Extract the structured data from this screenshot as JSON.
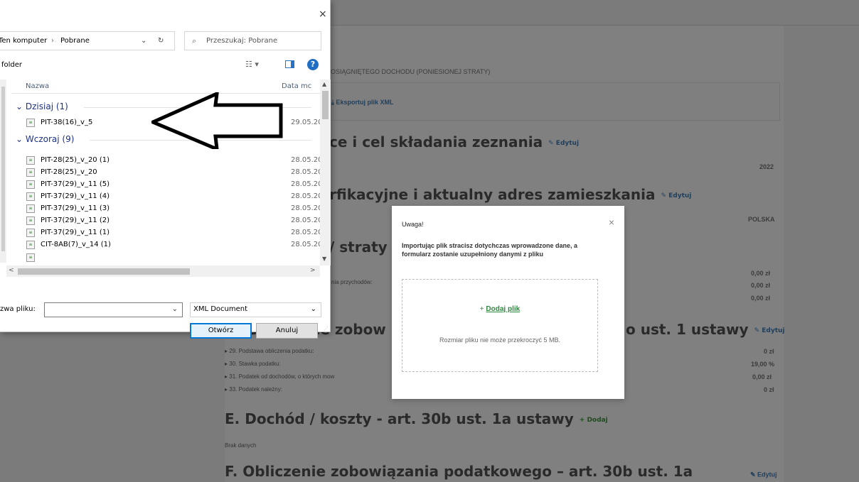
{
  "background": {
    "heading_fragment": "OSIĄGNIĘTEGO DOCHODU (PONIESIONEJ STRATY)",
    "export_link": "Eksportuj plik XML",
    "sections": {
      "b_title": "ce i cel składania zeznania",
      "c_title": "rfikacyjne i aktualny adres zamieszkania",
      "d_fragment_title": "/ straty -",
      "d_title": "D. Obliczenie zobow",
      "d_title_tail": "o ust. 1 ustawy",
      "e_title": "E. Dochód / koszty - art. 30b ust. 1a ustawy",
      "f_title": "F. Obliczenie zobowiązania podatkowego – art. 30b ust. 1a"
    },
    "edit_label": "Edytuj",
    "add_label": "+ Dodaj",
    "year_value": "2022",
    "country_value": "POLSKA",
    "income_label_fragment": "nia przychodów:",
    "money_values": [
      "0,00 zł",
      "0,00 zł",
      "0,00 zł"
    ],
    "tax_rows": [
      {
        "label": "▸ 29. Podstawa obliczenia podatku:",
        "value": "0 zł"
      },
      {
        "label": "▸ 30. Stawka podatku:",
        "value": "19,00 %"
      },
      {
        "label": "▸ 31. Podatek od dochodów, o których mow",
        "value": "0,00 zł"
      },
      {
        "label": "▸ 33. Podatek należny:",
        "value": "0 zł"
      }
    ],
    "no_data": "Brak danych"
  },
  "modal": {
    "title": "Uwaga!",
    "close": "×",
    "message": "Importując plik stracisz dotychczas wprowadzone dane, a formularz zostanie uzupełniony danymi z pliku",
    "add_plus": "+",
    "add_file": "Dodaj plik",
    "hint": "Rozmiar pliku nie może przekroczyć 5 MB."
  },
  "dialog": {
    "close": "×",
    "breadcrumb_root": "Ten komputer",
    "breadcrumb_sep": "›",
    "breadcrumb_current": "Pobrane",
    "search_placeholder": "Przeszukaj: Pobrane",
    "folder_label": "folder",
    "col_name": "Nazwa",
    "col_date": "Data mc",
    "groups": [
      {
        "label": "Dzisiaj (1)",
        "files": [
          {
            "name": "PIT-38(16)_v_5",
            "date": "29.05.20"
          }
        ]
      },
      {
        "label": "Wczoraj (9)",
        "files": [
          {
            "name": "PIT-28(25)_v_20 (1)",
            "date": "28.05.20"
          },
          {
            "name": "PIT-28(25)_v_20",
            "date": "28.05.20"
          },
          {
            "name": "PIT-37(29)_v_11 (5)",
            "date": "28.05.20"
          },
          {
            "name": "PIT-37(29)_v_11 (4)",
            "date": "28.05.20"
          },
          {
            "name": "PIT-37(29)_v_11 (3)",
            "date": "28.05.20"
          },
          {
            "name": "PIT-37(29)_v_11 (2)",
            "date": "28.05.20"
          },
          {
            "name": "PIT-37(29)_v_11 (1)",
            "date": "28.05.20"
          },
          {
            "name": "CIT-8AB(7)_v_14 (1)",
            "date": "28.05.20"
          }
        ]
      }
    ],
    "filename_label": "zwa pliku:",
    "filename_value": "",
    "filetype": "XML Document",
    "open_button": "Otwórz",
    "cancel_button": "Anuluj"
  },
  "icons": {
    "close": "close-icon",
    "refresh": "refresh-icon",
    "search": "search-icon",
    "view": "view-options-icon",
    "pane": "preview-pane-icon",
    "help": "help-icon",
    "file": "xml-file-icon",
    "arrow": "left-arrow-annotation-icon"
  },
  "colors": {
    "overlay_gray": "#7b7b7b",
    "accent_blue": "#0078d7",
    "group_blue": "#1e3287",
    "link_green": "#2b8a3e"
  }
}
